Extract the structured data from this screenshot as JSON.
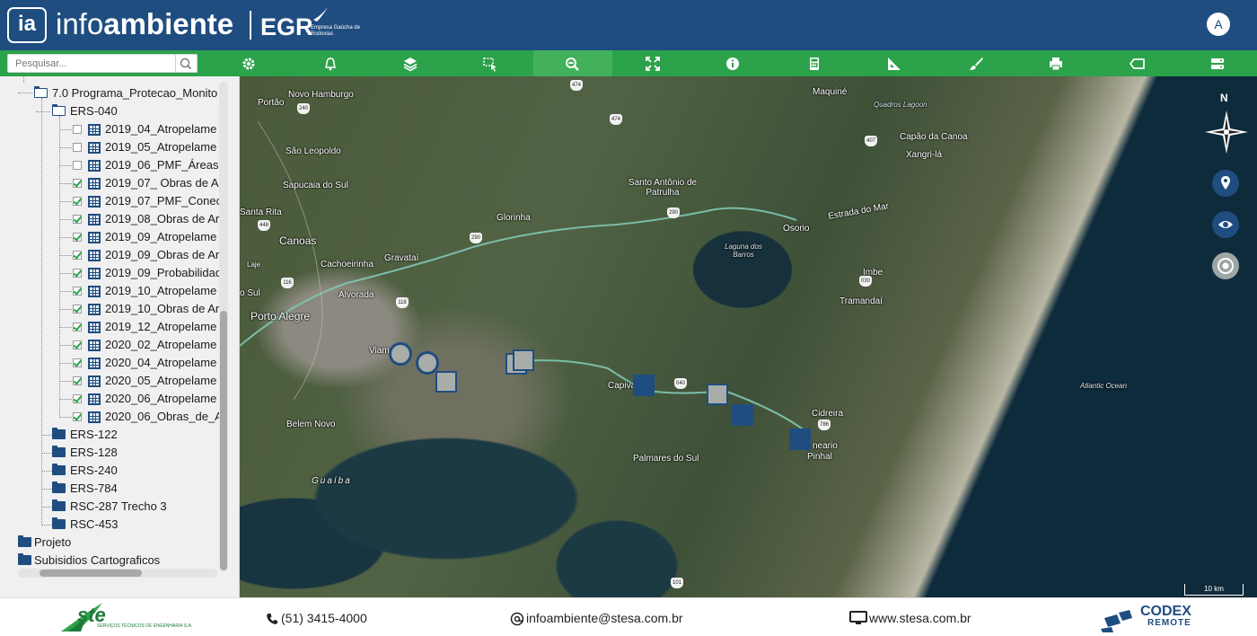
{
  "header": {
    "logo_icon": "ia",
    "title_light": "info",
    "title_bold": "ambiente",
    "partner_logo": "EGR",
    "partner_sub": "Empresa Gaúcha de Rodovias",
    "user_initial": "A"
  },
  "toolbar": {
    "search_placeholder": "Pesquisar...",
    "tools": [
      "settings-icon",
      "bell-icon",
      "layers-icon",
      "select-icon",
      "zoom-search-icon",
      "fullscreen-icon",
      "info-icon",
      "calculator-icon",
      "measure-icon",
      "brush-icon",
      "print-icon",
      "tag-icon",
      "server-icon"
    ],
    "active_tool": "zoom-search-icon"
  },
  "tree": {
    "root": "7.0 Programa_Protecao_Monito",
    "group": "ERS-040",
    "layers": [
      {
        "label": "2019_04_Atropelame",
        "checked": false
      },
      {
        "label": "2019_05_Atropelame",
        "checked": false
      },
      {
        "label": "2019_06_PMF_Áreas",
        "checked": false
      },
      {
        "label": "2019_07_ Obras de A",
        "checked": true
      },
      {
        "label": "2019_07_PMF_Conec",
        "checked": true
      },
      {
        "label": "2019_08_Obras de Ar",
        "checked": true
      },
      {
        "label": "2019_09_Atropelame",
        "checked": true
      },
      {
        "label": "2019_09_Obras de Ar",
        "checked": true
      },
      {
        "label": "2019_09_Probabilidad",
        "checked": true
      },
      {
        "label": "2019_10_Atropelame",
        "checked": true
      },
      {
        "label": "2019_10_Obras de Ar",
        "checked": true
      },
      {
        "label": "2019_12_Atropelame",
        "checked": true
      },
      {
        "label": "2020_02_Atropelame",
        "checked": true
      },
      {
        "label": "2020_04_Atropelame",
        "checked": true
      },
      {
        "label": "2020_05_Atropelame",
        "checked": true
      },
      {
        "label": "2020_06_Atropelame",
        "checked": true
      },
      {
        "label": "2020_06_Obras_de_A",
        "checked": true
      }
    ],
    "siblings": [
      "ERS-122",
      "ERS-128",
      "ERS-240",
      "ERS-784",
      "RSC-287 Trecho 3",
      "RSC-453"
    ],
    "top_level": [
      "Projeto",
      "Subisidios Cartograficos"
    ]
  },
  "map": {
    "places": {
      "novo_hamburgo": "Novo Hamburgo",
      "portao": "Portão",
      "sao_leopoldo": "São Leopoldo",
      "sapucaia": "Sapucaia do Sul",
      "santa_rita": "Santa Rita",
      "canoas": "Canoas",
      "cachoeirinha": "Cachoeirinha",
      "gravatai": "Gravataí",
      "alvorada": "Alvorada",
      "porto_alegre": "Porto Alegre",
      "glorinha": "Glorinha",
      "santo_antonio": "Santo Antônio de Patrulha",
      "viamao": "Viam",
      "capivari": "Capiva",
      "belem_novo": "Belem Novo",
      "guaiba": "Guaíba",
      "palmares": "Palmares do Sul",
      "maquine": "Maquiné",
      "quadros": "Quadros Lagoon",
      "capao": "Capão da Canoa",
      "xangrila": "Xangri-lá",
      "osorio": "Osorio",
      "estrada": "Estrada do Mar",
      "laguna": "Laguna dos Barros",
      "imbe": "Imbe",
      "tramandai": "Tramandaí",
      "cidreira": "Cidreira",
      "pinhal": "Pinhal",
      "balneario": "neario",
      "atlantic": "Atlantic Ocean",
      "sul": "o Sul",
      "laje": "Laje"
    },
    "shields": [
      "474",
      "240",
      "474",
      "448",
      "290",
      "290",
      "116",
      "118",
      "407",
      "030",
      "040",
      "786",
      "101"
    ],
    "compass_label": "N",
    "scale_label": "10 km"
  },
  "footer": {
    "company": "ste",
    "company_sub": "SERVIÇOS TÉCNICOS DE ENGENHARIA S.A.",
    "phone": "(51) 3415-4000",
    "email": "infoambiente@stesa.com.br",
    "website": "www.stesa.com.br",
    "partner": "CODEX",
    "partner_sub": "REMOTE"
  }
}
